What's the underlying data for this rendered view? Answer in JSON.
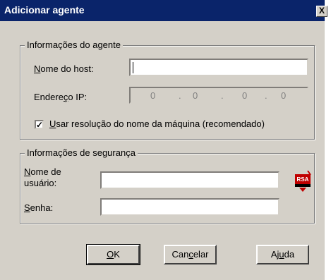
{
  "window": {
    "title": "Adicionar agente",
    "close_glyph": "X"
  },
  "agent_group": {
    "legend": "Informações do agente",
    "host_label_u": "N",
    "host_label_rest": "ome do host:",
    "host_value": "",
    "ip_label_pre": "Endere",
    "ip_label_u": "ç",
    "ip_label_rest": "o IP:",
    "ip_parts": [
      "0",
      "0",
      "0",
      "0"
    ],
    "ip_dot": ".",
    "checkbox_checked": true,
    "checkbox_label_u": "U",
    "checkbox_label_rest": "sar resolução do nome da máquina (recomendado)"
  },
  "security_group": {
    "legend": "Informações de segurança",
    "user_label_u": "N",
    "user_label_line1_rest": "ome de",
    "user_label_line2": "usuário:",
    "user_value": "",
    "pass_label_u": "S",
    "pass_label_rest": "enha:",
    "pass_value": "",
    "logo_text": "RSA"
  },
  "buttons": {
    "ok_u": "O",
    "ok_rest": "K",
    "cancel_pre": "Can",
    "cancel_u": "c",
    "cancel_rest": "elar",
    "help_pre": "Aj",
    "help_u": "u",
    "help_rest": "da"
  }
}
